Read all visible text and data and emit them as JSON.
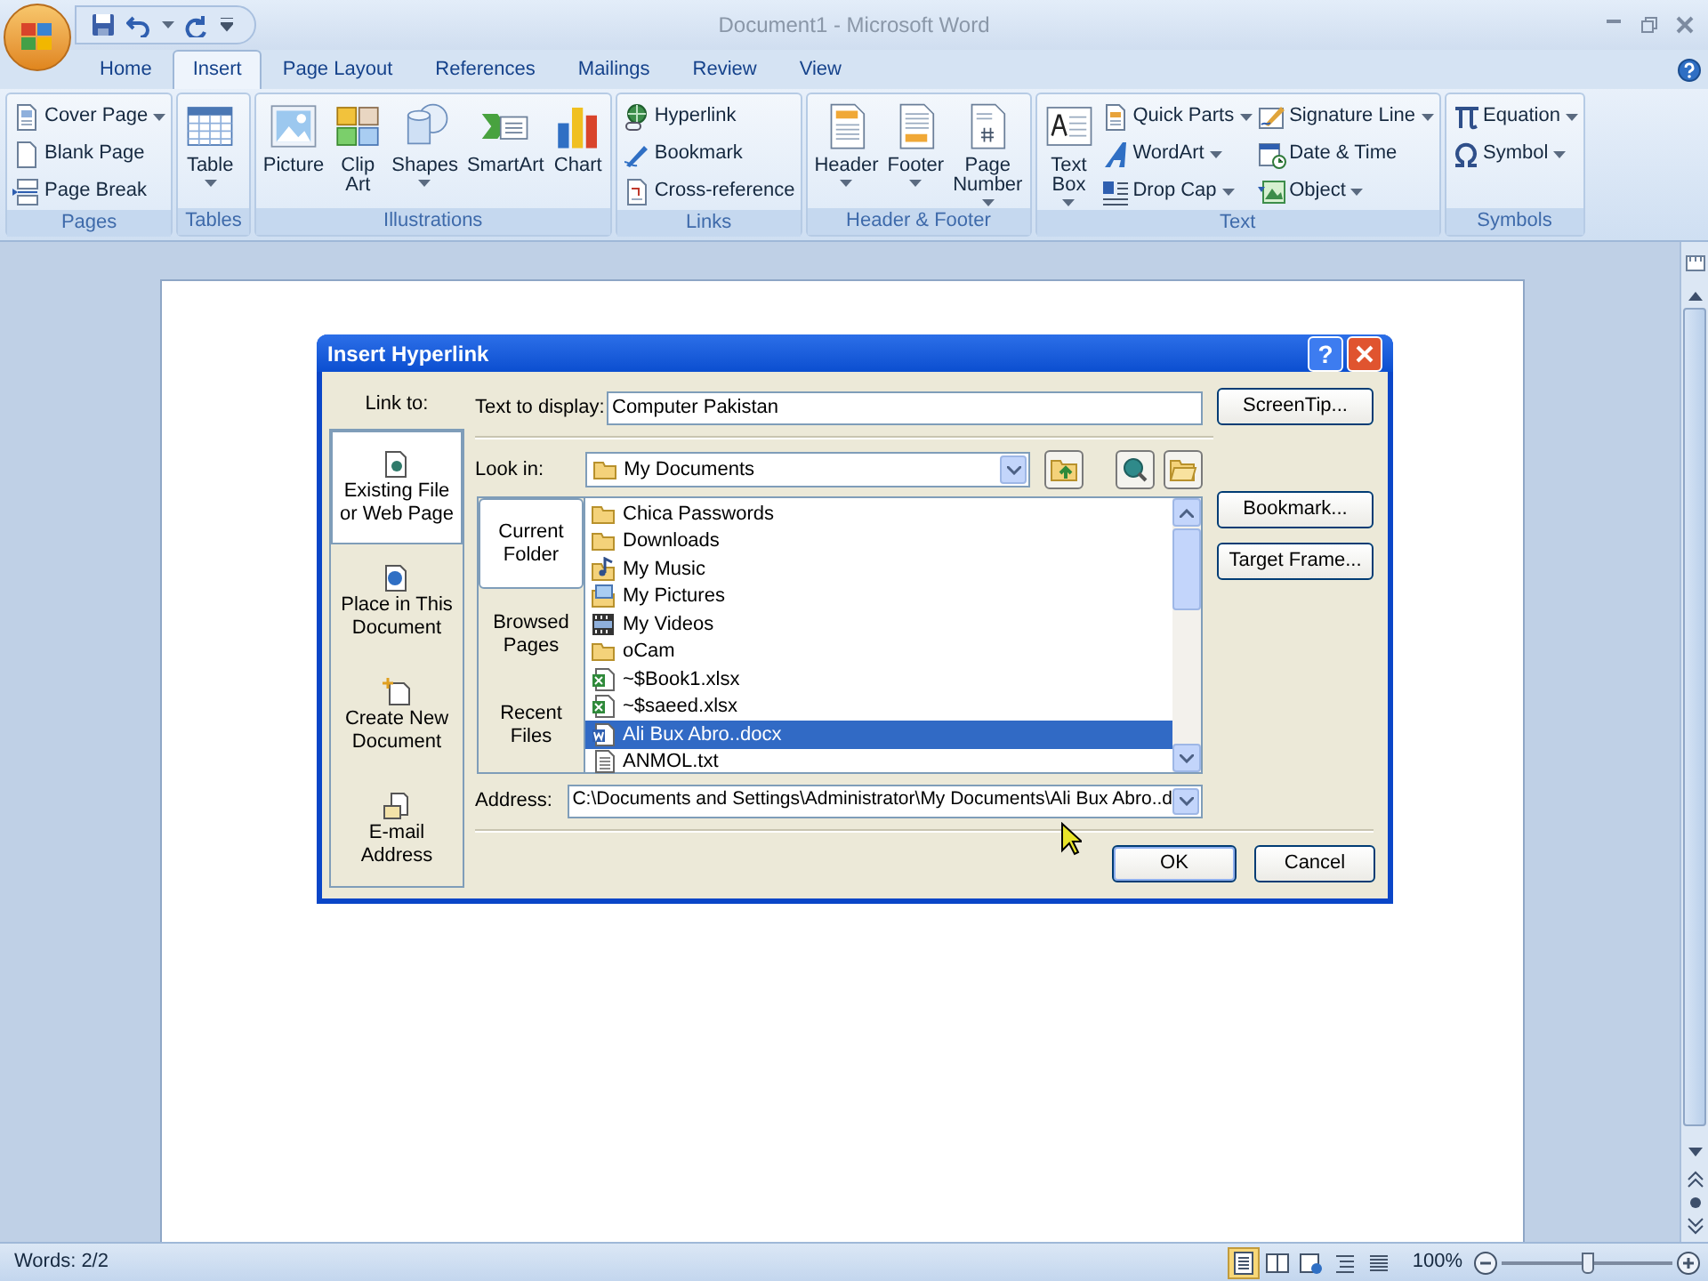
{
  "window": {
    "title": "Document1 - Microsoft Word"
  },
  "ribbon": {
    "tabs": [
      {
        "label": "Home",
        "selected": false
      },
      {
        "label": "Insert",
        "selected": true
      },
      {
        "label": "Page Layout",
        "selected": false
      },
      {
        "label": "References",
        "selected": false
      },
      {
        "label": "Mailings",
        "selected": false
      },
      {
        "label": "Review",
        "selected": false
      },
      {
        "label": "View",
        "selected": false
      }
    ],
    "groups": [
      {
        "label": "Pages",
        "items": [
          {
            "label": "Cover Page",
            "kind": "small",
            "dropdown": true
          },
          {
            "label": "Blank Page",
            "kind": "small",
            "dropdown": false
          },
          {
            "label": "Page Break",
            "kind": "small",
            "dropdown": false
          }
        ]
      },
      {
        "label": "Tables",
        "items": [
          {
            "label": "Table",
            "kind": "large",
            "dropdown": true
          }
        ]
      },
      {
        "label": "Illustrations",
        "items": [
          {
            "label": "Picture",
            "kind": "large",
            "dropdown": false
          },
          {
            "label": "Clip Art",
            "kind": "large",
            "dropdown": false
          },
          {
            "label": "Shapes",
            "kind": "large",
            "dropdown": true
          },
          {
            "label": "SmartArt",
            "kind": "large",
            "dropdown": false
          },
          {
            "label": "Chart",
            "kind": "large",
            "dropdown": false
          }
        ]
      },
      {
        "label": "Links",
        "items": [
          {
            "label": "Hyperlink",
            "kind": "small",
            "dropdown": false
          },
          {
            "label": "Bookmark",
            "kind": "small",
            "dropdown": false
          },
          {
            "label": "Cross-reference",
            "kind": "small",
            "dropdown": false
          }
        ]
      },
      {
        "label": "Header & Footer",
        "items": [
          {
            "label": "Header",
            "kind": "large",
            "dropdown": true
          },
          {
            "label": "Footer",
            "kind": "large",
            "dropdown": true
          },
          {
            "label": "Page Number",
            "kind": "large",
            "dropdown": true
          }
        ]
      },
      {
        "label": "Text",
        "items": [
          {
            "label": "Text Box",
            "kind": "large",
            "dropdown": true
          },
          {
            "label": "Quick Parts",
            "kind": "small",
            "dropdown": true
          },
          {
            "label": "WordArt",
            "kind": "small",
            "dropdown": true
          },
          {
            "label": "Drop Cap",
            "kind": "small",
            "dropdown": true
          },
          {
            "label": "Signature Line",
            "kind": "small",
            "dropdown": true
          },
          {
            "label": "Date & Time",
            "kind": "small",
            "dropdown": false
          },
          {
            "label": "Object",
            "kind": "small",
            "dropdown": true
          }
        ]
      },
      {
        "label": "Symbols",
        "items": [
          {
            "label": "Equation",
            "kind": "small",
            "dropdown": true
          },
          {
            "label": "Symbol",
            "kind": "small",
            "dropdown": true
          }
        ]
      }
    ]
  },
  "dialog": {
    "title": "Insert Hyperlink",
    "help_button": "?",
    "link_to_label": "Link to:",
    "link_to": [
      {
        "label": "Existing File or Web Page",
        "selected": true
      },
      {
        "label": "Place in This Document",
        "selected": false
      },
      {
        "label": "Create New Document",
        "selected": false
      },
      {
        "label": "E-mail Address",
        "selected": false
      }
    ],
    "text_to_display": {
      "label": "Text to display:",
      "value": "Computer Pakistan"
    },
    "screentip_button": "ScreenTip...",
    "look_in": {
      "label": "Look in:",
      "value": "My Documents"
    },
    "views": [
      {
        "label": "Current Folder",
        "selected": true
      },
      {
        "label": "Browsed Pages",
        "selected": false
      },
      {
        "label": "Recent Files",
        "selected": false
      }
    ],
    "files": [
      {
        "name": "Chica Passwords",
        "kind": "folder",
        "selected": false
      },
      {
        "name": "Downloads",
        "kind": "folder",
        "selected": false
      },
      {
        "name": "My Music",
        "kind": "music",
        "selected": false
      },
      {
        "name": "My Pictures",
        "kind": "pictures",
        "selected": false
      },
      {
        "name": "My Videos",
        "kind": "videos",
        "selected": false
      },
      {
        "name": "oCam",
        "kind": "folder",
        "selected": false
      },
      {
        "name": "~$Book1.xlsx",
        "kind": "excel",
        "selected": false
      },
      {
        "name": "~$saeed.xlsx",
        "kind": "excel",
        "selected": false
      },
      {
        "name": "Ali Bux Abro..docx",
        "kind": "word",
        "selected": true
      },
      {
        "name": "ANMOL.txt",
        "kind": "text",
        "selected": false
      }
    ],
    "bookmark_button": "Bookmark...",
    "target_frame_button": "Target Frame...",
    "address": {
      "label": "Address:",
      "value": "C:\\Documents and Settings\\Administrator\\My Documents\\Ali Bux Abro..d"
    },
    "buttons": [
      "OK",
      "Cancel"
    ]
  },
  "status_bar": {
    "words": "Words: 2/2",
    "view_buttons": [
      {
        "selected": true
      },
      {
        "selected": false
      },
      {
        "selected": false
      },
      {
        "selected": false
      },
      {
        "selected": false
      }
    ],
    "zoom": "100%",
    "zoom_slider": {
      "level": 0.5
    }
  }
}
